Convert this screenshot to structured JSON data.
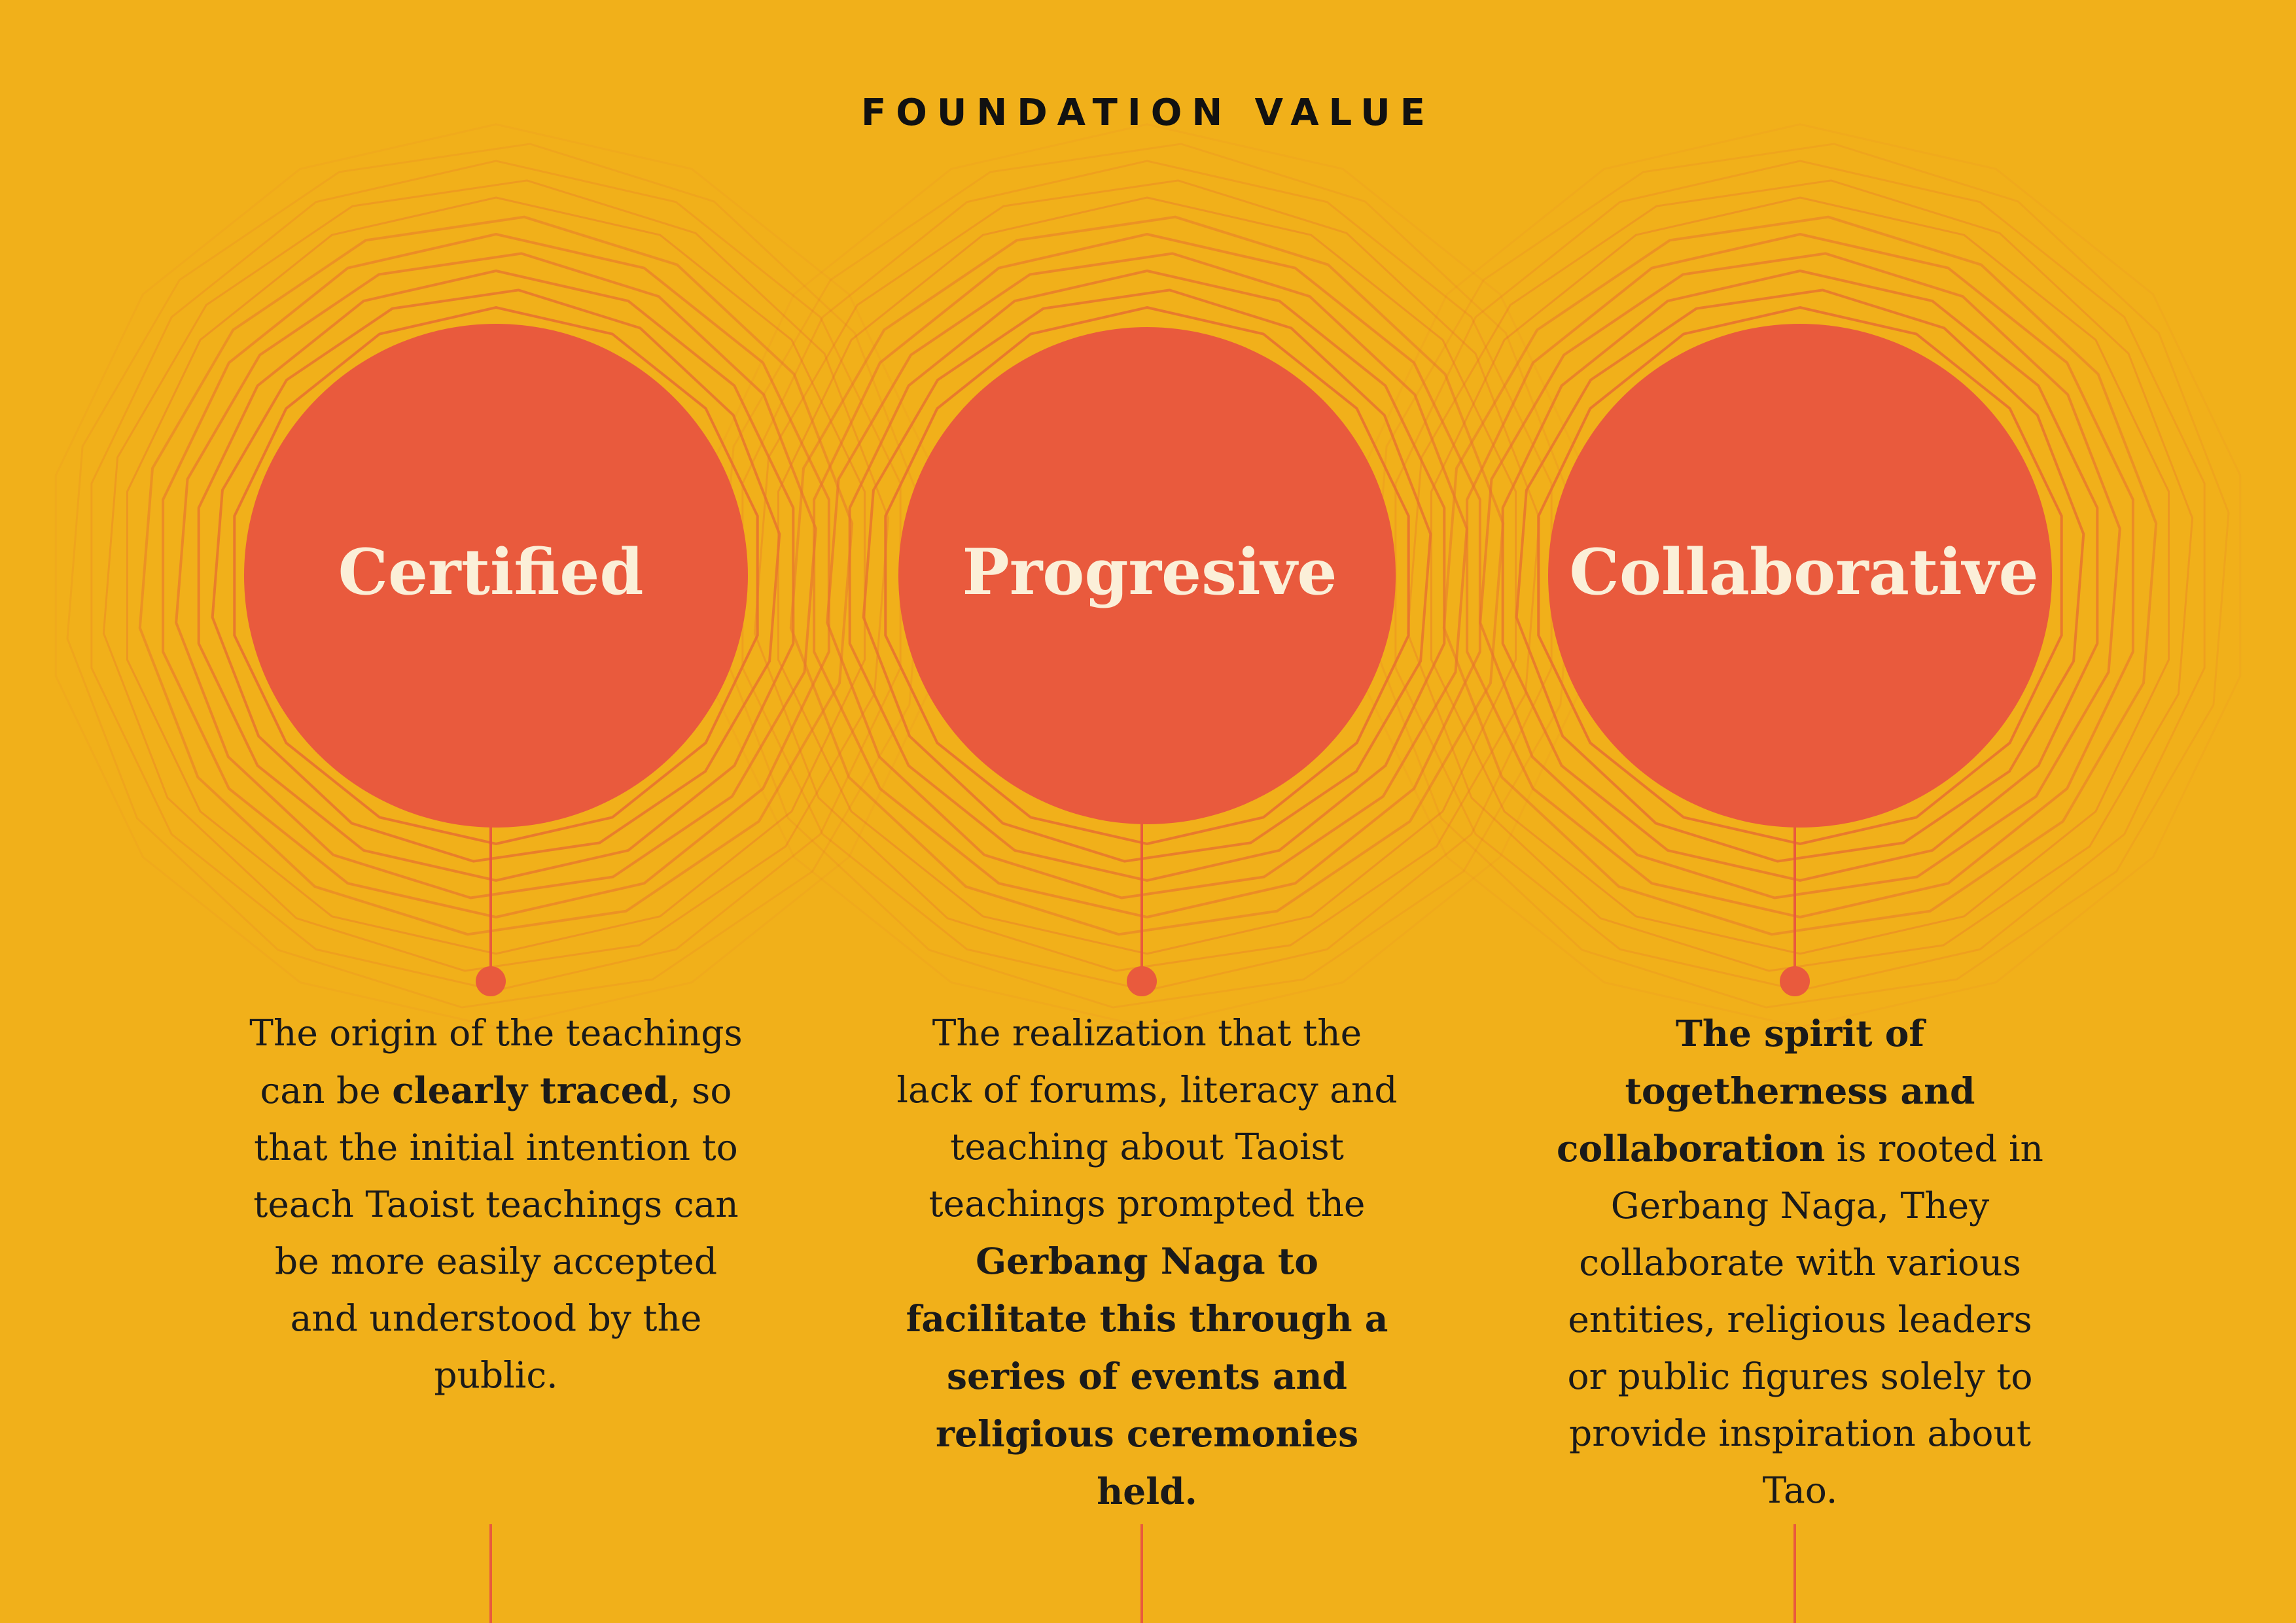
{
  "heading": "FOUNDATION VALUE",
  "colors": {
    "background": "#F1B01A",
    "circle": "#E95A3D",
    "ring": "#E8762E",
    "connector": "#E95A3D",
    "label_text": "#FBEFD8",
    "body_text": "#1A1A1A"
  },
  "values": [
    {
      "title": "Certified",
      "description": [
        {
          "text": "The origin of the teachings can be ",
          "bold": false
        },
        {
          "text": "clearly traced",
          "bold": true
        },
        {
          "text": ", so that the initial intention to teach Taoist teachings can be more easily accepted and understood by the public.",
          "bold": false
        }
      ]
    },
    {
      "title": "Progresive",
      "description": [
        {
          "text": "The realization that the lack of forums, literacy and teaching about Taoist teachings prompted the ",
          "bold": false
        },
        {
          "text": "Gerbang Naga to facilitate this through a series of events and religious ceremonies held.",
          "bold": true
        }
      ]
    },
    {
      "title": "Collaborative",
      "description": [
        {
          "text": "The spirit of togetherness and collaboration",
          "bold": true
        },
        {
          "text": " is rooted in Gerbang Naga, They collaborate with various entities, religious leaders or public figures solely to provide inspiration about Tao.",
          "bold": false
        }
      ]
    }
  ]
}
